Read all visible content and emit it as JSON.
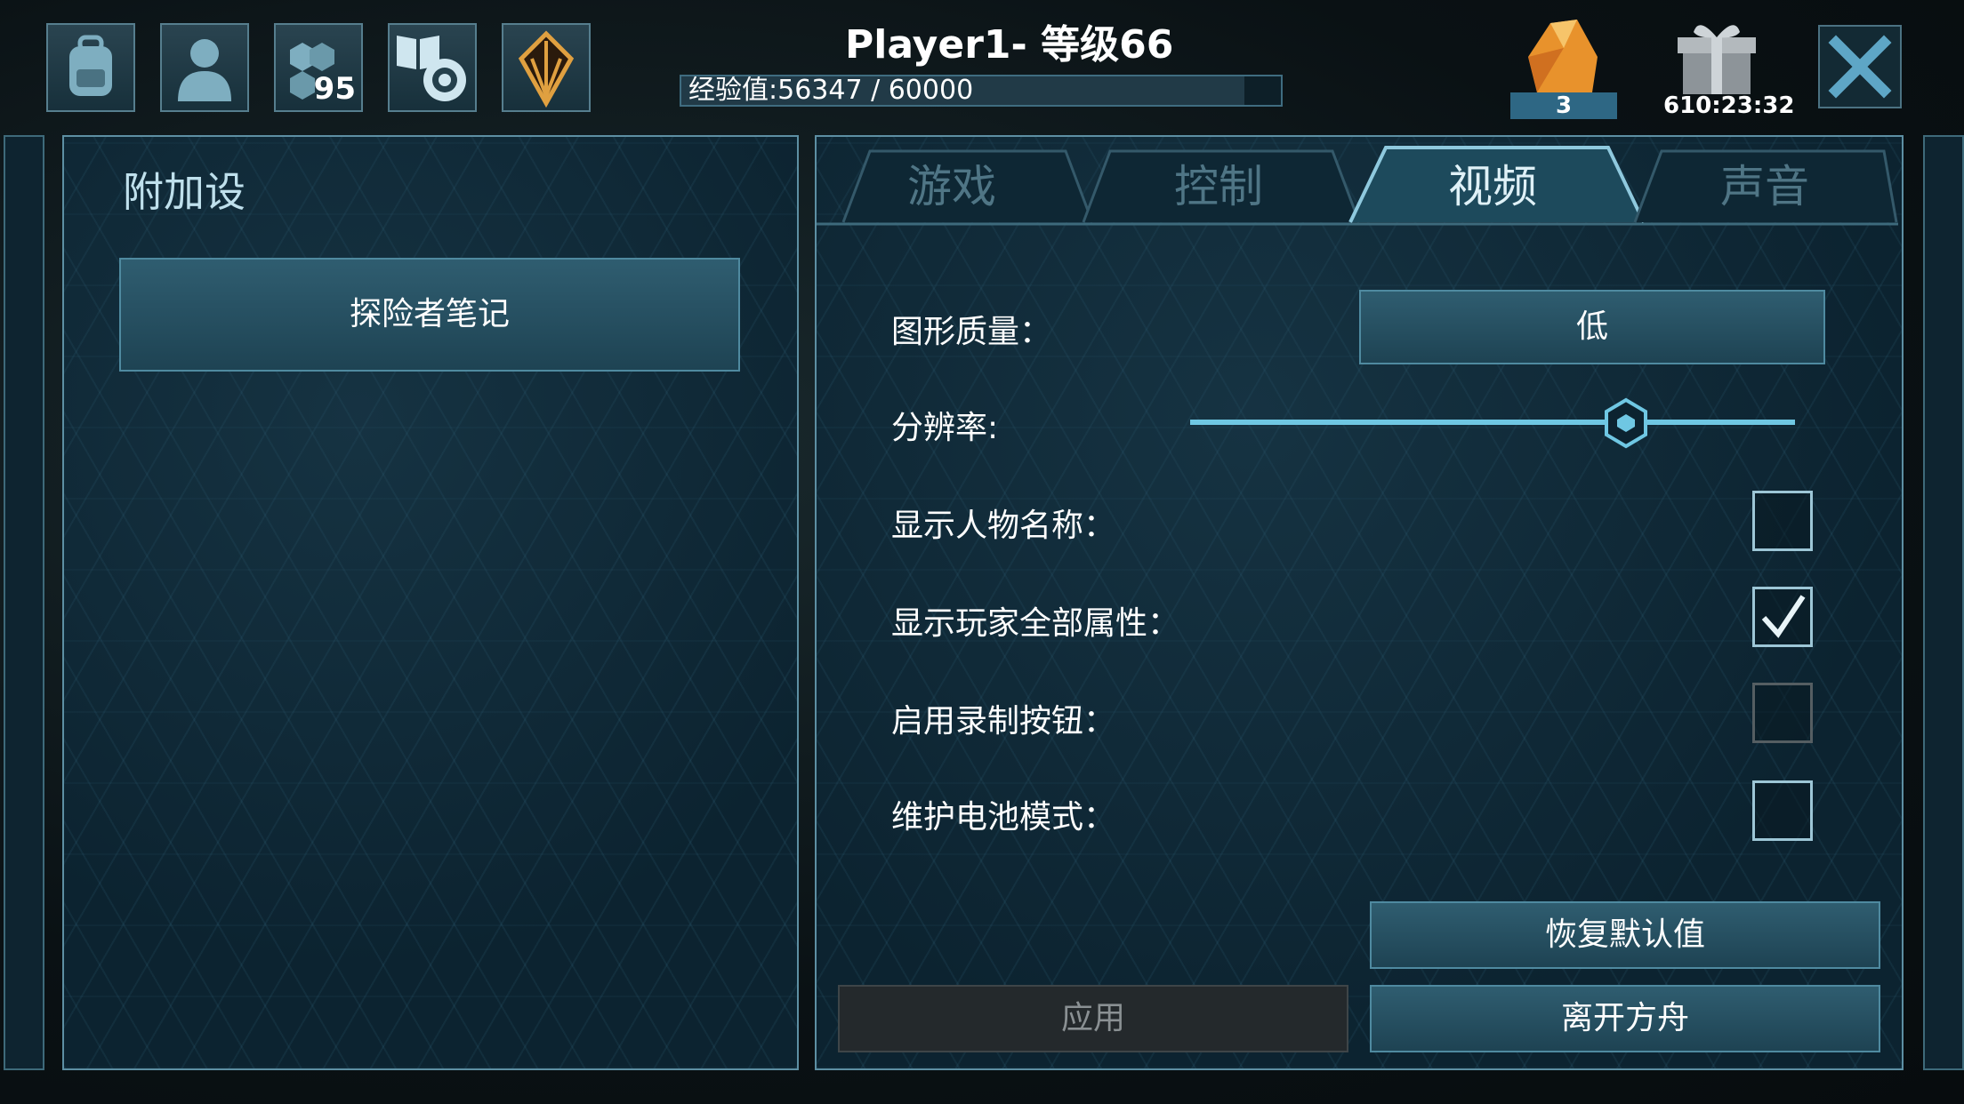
{
  "header": {
    "player_title": "Player1- 等级66",
    "xp_text": "经验值:56347 / 60000",
    "xp_progress": 0.939,
    "icons": [
      {
        "name": "backpack-icon"
      },
      {
        "name": "character-icon"
      },
      {
        "name": "engrams-icon",
        "count": "95"
      },
      {
        "name": "notes-settings-icon"
      },
      {
        "name": "tribe-crest-icon"
      }
    ],
    "amber_count": "3",
    "gift_timer": "610:23:32"
  },
  "left_panel": {
    "title": "附加设",
    "explorer_notes_label": "探险者笔记"
  },
  "tabs": [
    {
      "label": "游戏",
      "active": false
    },
    {
      "label": "控制",
      "active": false
    },
    {
      "label": "视频",
      "active": true
    },
    {
      "label": "声音",
      "active": false
    }
  ],
  "settings": {
    "graphics_quality_label": "图形质量：",
    "graphics_quality_value": "低",
    "resolution_label": "分辨率:",
    "resolution_value": 0.72,
    "show_names_label": "显示人物名称：",
    "show_names_checked": false,
    "show_all_stats_label": "显示玩家全部属性：",
    "show_all_stats_checked": true,
    "record_button_label": "启用录制按钮：",
    "record_button_checked": false,
    "battery_mode_label": "维护电池模式：",
    "battery_mode_checked": false
  },
  "buttons": {
    "reset_defaults": "恢复默认值",
    "apply": "应用",
    "leave_ark": "离开方舟"
  },
  "colors": {
    "accent": "#6fc7e3",
    "panel_border": "#5d8fa3",
    "button_fill": "#2a5466"
  }
}
